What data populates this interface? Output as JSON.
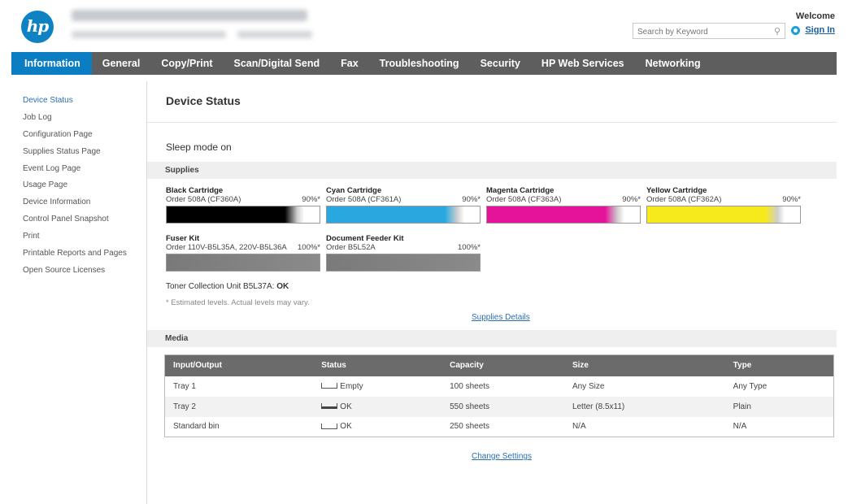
{
  "header": {
    "logo_text": "hp",
    "search_placeholder": "Search by Keyword",
    "welcome": "Welcome",
    "sign_in": "Sign In"
  },
  "nav": {
    "tabs": [
      "Information",
      "General",
      "Copy/Print",
      "Scan/Digital Send",
      "Fax",
      "Troubleshooting",
      "Security",
      "HP Web Services",
      "Networking"
    ],
    "active": "Information"
  },
  "sidebar": {
    "items": [
      "Device Status",
      "Job Log",
      "Configuration Page",
      "Supplies Status Page",
      "Event Log Page",
      "Usage Page",
      "Device Information",
      "Control Panel Snapshot",
      "Print",
      "Printable Reports and Pages",
      "Open Source Licenses"
    ],
    "active": "Device Status"
  },
  "main": {
    "title": "Device Status",
    "sleep_mode": "Sleep mode on",
    "supplies_header": "Supplies",
    "cartridges": [
      {
        "name": "Black Cartridge",
        "order": "Order 508A (CF360A)",
        "percent": "90%*",
        "level": 0.9,
        "color": "#000000"
      },
      {
        "name": "Cyan Cartridge",
        "order": "Order 508A (CF361A)",
        "percent": "90%*",
        "level": 0.9,
        "color": "#29a8e0"
      },
      {
        "name": "Magenta Cartridge",
        "order": "Order 508A (CF363A)",
        "percent": "90%*",
        "level": 0.9,
        "color": "#e5139a"
      },
      {
        "name": "Yellow Cartridge",
        "order": "Order 508A (CF362A)",
        "percent": "90%*",
        "level": 0.9,
        "color": "#f7ea1c"
      }
    ],
    "kits": [
      {
        "name": "Fuser Kit",
        "order": "Order 110V-B5L35A, 220V-B5L36A",
        "percent": "100%*",
        "level": 1.0,
        "color": "#7a7a7a"
      },
      {
        "name": "Document Feeder Kit",
        "order": "Order B5L52A",
        "percent": "100%*",
        "level": 1.0,
        "color": "#7a7a7a"
      }
    ],
    "toner_collection_label": "Toner Collection Unit B5L37A:",
    "toner_collection_value": "OK",
    "estimated_note": "* Estimated levels. Actual levels may vary.",
    "supplies_details_link": "Supplies Details",
    "media_header": "Media",
    "media_columns": [
      "Input/Output",
      "Status",
      "Capacity",
      "Size",
      "Type"
    ],
    "media_rows": [
      {
        "io": "Tray 1",
        "status": "Empty",
        "capacity": "100 sheets",
        "size": "Any Size",
        "type": "Any Type"
      },
      {
        "io": "Tray 2",
        "status": "OK",
        "capacity": "550 sheets",
        "size": "Letter (8.5x11)",
        "type": "Plain"
      },
      {
        "io": "Standard bin",
        "status": "OK",
        "capacity": "250 sheets",
        "size": "N/A",
        "type": "N/A"
      }
    ],
    "change_settings_link": "Change Settings"
  }
}
